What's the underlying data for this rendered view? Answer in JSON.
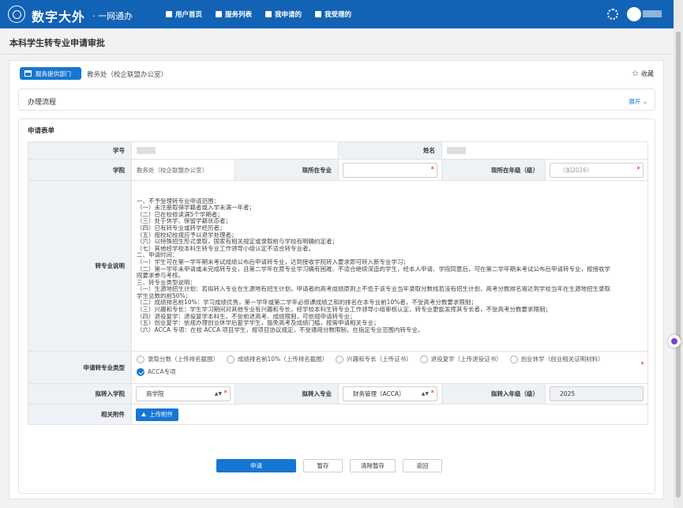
{
  "header": {
    "brand": "数字大外",
    "brand_sub": "· 一网通办",
    "nav": [
      {
        "label": "用户首页",
        "icon": "home-icon"
      },
      {
        "label": "服务列表",
        "icon": "service-list-icon"
      },
      {
        "label": "我申请的",
        "icon": "application-icon"
      },
      {
        "label": "我受理的",
        "icon": "handled-icon"
      }
    ]
  },
  "page": {
    "title": "本科学生转专业申请审批"
  },
  "dept": {
    "button_label": "服务提供部门",
    "name": "教务处（校企联盟办公室）",
    "favorite_label": "收藏"
  },
  "flow": {
    "title": "办理流程",
    "expand_label": "展开"
  },
  "form": {
    "title": "申请表单",
    "labels": {
      "student_id": "学号",
      "name": "姓名",
      "college": "学院",
      "current_major": "现所在专业",
      "current_grade": "现所在年级（级）",
      "description": "转专业说明",
      "type": "申请转专业类型",
      "target_college": "拟转入学院",
      "target_major": "拟转入专业",
      "target_grade": "拟转入年级（级）",
      "attachments": "相关附件"
    },
    "values": {
      "college": "教务处（校企联盟办公室）",
      "current_major": "",
      "current_grade_placeholder": "（如2026）",
      "target_college": "商学院",
      "target_major": "财务管理（ACCA）",
      "target_grade": "2025"
    },
    "description_lines": [
      "一、不予受理转专业申请范围：",
      "（一）未注册取得学籍者或入学未满一年者；",
      "（二）已在校修读满5个学期者；",
      "（三）处于休学、保留学籍状态者；",
      "（四）已有转专业或转学经历者；",
      "（五）按校纪校规应予以退学处理者；",
      "（六）以特殊招生形式录取，国家有相关规定或录取前与学校有明确约定者；",
      "（七）其他经学校本科生转专业工作领导小组认定不适合转专业者。",
      "二、申请时间：",
      "（一）学生可在第一学年期末考试成绩公布后申请转专业，达到接收学院转入要求即可转入新专业学习；",
      "（二）第一学年未申请或未完成转专业，且第二学年在原专业学习确有困难、不适合继续深造的学生，经本人申请、学院同意后，可在第二学年期末考试公布后申请转专业，按接收学",
      "院要求参与考核。",
      "三、转专业类型说明：",
      "（一）生源地招生计划：若拟转入专业在生源地有招生计划，申请者的高考成绩原则上不低于该专业当年录取分数线若没有招生计划，高考分数排名需达到学校当年在生源地招生录取",
      "学生总数的前50%；",
      "（二）成绩排名前10%：学习成绩优秀，第一学年或第二学年必修课成绩之和的排名在本专业前10%者，不受高考分数要求限制；",
      "（三）兴趣和专长：学生学习期间对其他专业有兴趣和专长，经学校本科生转专业工作领导小组审核认定，转专业更能发挥其专长者，不受高考分数要求限制；",
      "（四）退役复学：退役复学本科生，不受前述高考、成绩限制，可依规申请转专业；",
      "（五）创业复学：依规办理创业休学后复学学生，豁免高考及成绩门槛，按需申请相关专业；",
      "（六）ACCA 专项：在校 ACCA 项目学生，按项目协议规定，不受通用分数限制，在指定专业范围内转专业。"
    ],
    "types": [
      {
        "label": "录取分数（上传排名截图）",
        "checked": false
      },
      {
        "label": "成绩排名前10%（上传排名截图）",
        "checked": false
      },
      {
        "label": "兴趣和专长（上传证书）",
        "checked": false
      },
      {
        "label": "退役复学（上传退役证书）",
        "checked": false
      },
      {
        "label": "创业休学（创业相关证明材料）",
        "checked": false
      },
      {
        "label": "ACCA专项",
        "checked": true
      }
    ],
    "upload_label": "上传附件"
  },
  "actions": {
    "apply": "申请",
    "save": "暂存",
    "clear": "清除暂存",
    "back": "返回"
  },
  "colors": {
    "header": "#1262b5",
    "accent": "#1677d2",
    "required": "#e02020"
  }
}
